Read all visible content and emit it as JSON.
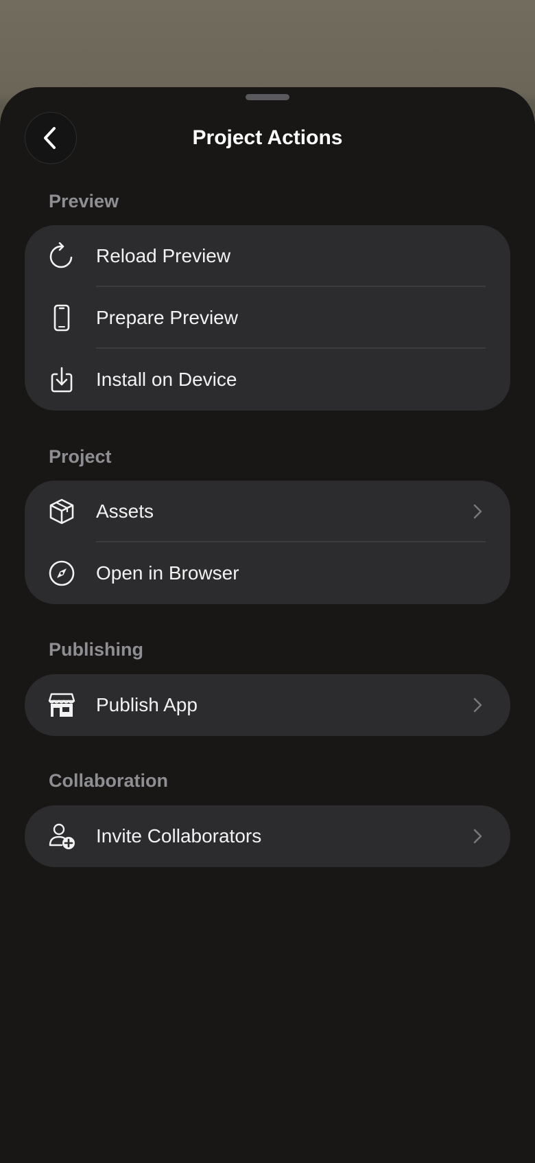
{
  "header": {
    "title": "Project Actions",
    "back_icon": "chevron-left-icon"
  },
  "sections": {
    "preview": {
      "label": "Preview",
      "items": [
        {
          "label": "Reload Preview",
          "icon": "reload-icon"
        },
        {
          "label": "Prepare Preview",
          "icon": "phone-icon"
        },
        {
          "label": "Install on Device",
          "icon": "download-tray-icon"
        }
      ]
    },
    "project": {
      "label": "Project",
      "items": [
        {
          "label": "Assets",
          "icon": "cube-icon",
          "chevron": true
        },
        {
          "label": "Open in Browser",
          "icon": "compass-icon"
        }
      ]
    },
    "publishing": {
      "label": "Publishing",
      "items": [
        {
          "label": "Publish App",
          "icon": "storefront-icon",
          "chevron": true
        }
      ]
    },
    "collaboration": {
      "label": "Collaboration",
      "items": [
        {
          "label": "Invite Collaborators",
          "icon": "person-add-icon",
          "chevron": true
        }
      ]
    }
  },
  "colors": {
    "sheet_background": "#181716",
    "group_background": "#2c2c2e",
    "section_label": "#8e8e93",
    "text": "#f2f2f2"
  }
}
